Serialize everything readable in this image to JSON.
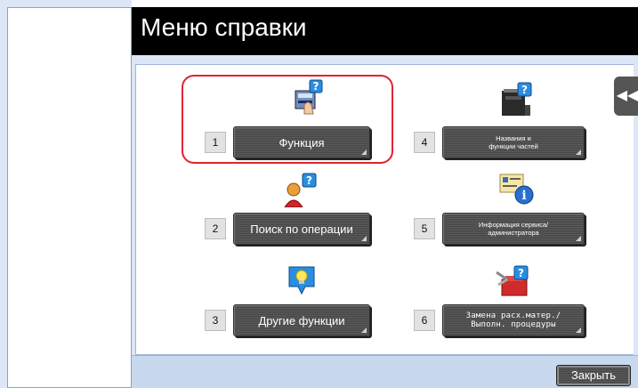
{
  "window": {
    "title": "Меню справки"
  },
  "items": [
    {
      "number": "1",
      "label": "Функция",
      "icon": "function-help-icon"
    },
    {
      "number": "2",
      "label": "Поиск по операции",
      "icon": "operation-search-icon"
    },
    {
      "number": "3",
      "label": "Другие функции",
      "icon": "other-functions-icon"
    },
    {
      "number": "4",
      "label_line1": "Названия и",
      "label_line2": "функции частей",
      "icon": "machine-parts-icon"
    },
    {
      "number": "5",
      "label_line1": "Информация сервиса/",
      "label_line2": "администратора",
      "icon": "service-info-icon"
    },
    {
      "number": "6",
      "label_line1": "Замена расх.матер./",
      "label_line2": "Выполн. процедуры",
      "icon": "replace-consumables-icon"
    }
  ],
  "side_tab": {
    "glyph": "◀◀"
  },
  "close": {
    "label": "Закрыть"
  },
  "colors": {
    "highlight": "#e0232f",
    "panel_bg": "#dde6f6",
    "button_bg": "#4f4f4f"
  }
}
